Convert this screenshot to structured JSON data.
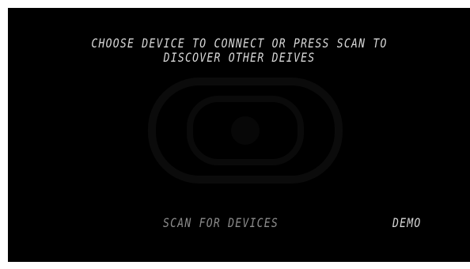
{
  "prompt": {
    "line1": "CHOOSE DEVICE TO CONNECT OR PRESS SCAN TO",
    "line2": "DISCOVER OTHER DEIVES"
  },
  "actions": {
    "scan_label": "SCAN FOR DEVICES",
    "demo_label": "DEMO"
  },
  "colors": {
    "background": "#000000",
    "text_primary": "#d8d8d8",
    "text_dim": "#8c8c8c",
    "frame": "#ffffff"
  }
}
